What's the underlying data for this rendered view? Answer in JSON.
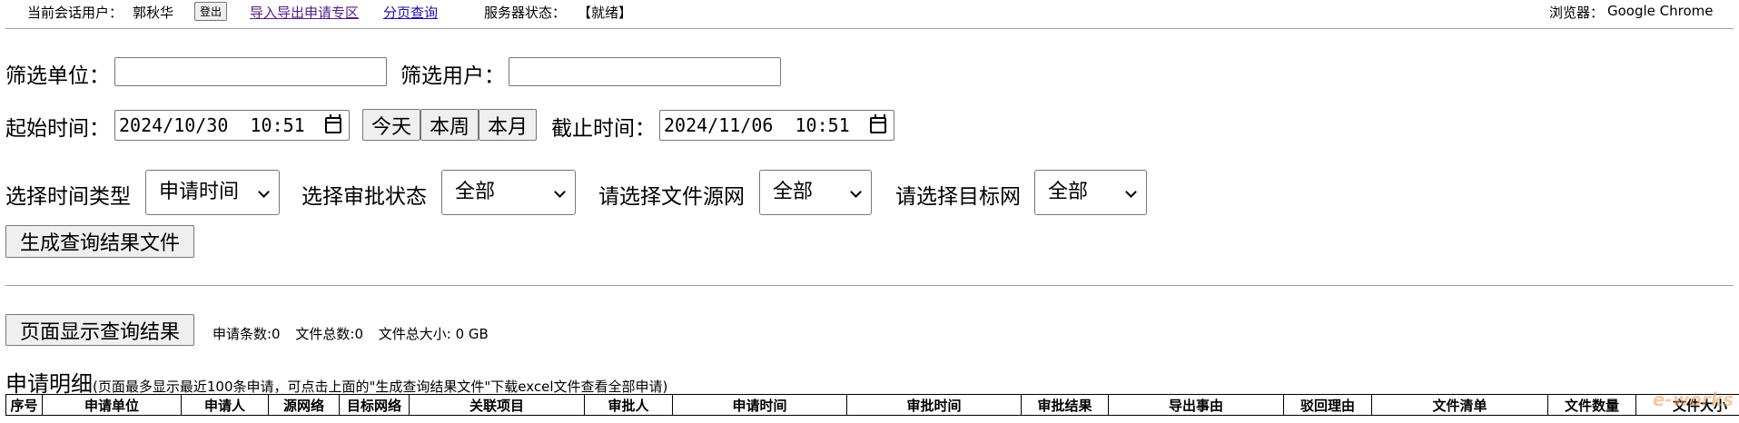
{
  "topbar": {
    "session_user_label": "当前会话用户：",
    "session_user": "郭秋华",
    "logout": "登出",
    "link_import_export": "导入导出申请专区",
    "link_paging": "分页查询",
    "server_status_label": "服务器状态：",
    "server_status": "【就绪】",
    "browser_label": "浏览器：",
    "browser": "Google Chrome"
  },
  "filters": {
    "unit_label": "筛选单位：",
    "unit_value": "",
    "user_label": "筛选用户：",
    "user_value": "",
    "start_label": "起始时间：",
    "start_value": "2024/10/30  10:51",
    "today": "今天",
    "this_week": "本周",
    "this_month": "本月",
    "end_label": "截止时间：",
    "end_value": "2024/11/06  10:51",
    "time_type_label": "选择时间类型",
    "time_type_value": "申请时间",
    "approval_label": "选择审批状态",
    "approval_value": "全部",
    "source_net_label": "请选择文件源网",
    "source_net_value": "全部",
    "target_net_label": "请选择目标网",
    "target_net_value": "全部",
    "generate_file": "生成查询结果文件"
  },
  "results": {
    "show_button": "页面显示查询结果",
    "count_label": "申请条数:0",
    "file_total_label": "文件总数:0",
    "file_size_label": "文件总大小: 0 GB"
  },
  "detail": {
    "title": "申请明细",
    "note": "(页面最多显示最近100条申请，可点击上面的\"生成查询结果文件\"下载excel文件查看全部申请)",
    "columns": [
      "序号",
      "申请单位",
      "申请人",
      "源网络",
      "目标网络",
      "关联项目",
      "审批人",
      "申请时间",
      "审批时间",
      "审批结果",
      "导出事由",
      "驳回理由",
      "文件清单",
      "文件数量",
      "文件大小"
    ]
  },
  "watermark": "e-works"
}
